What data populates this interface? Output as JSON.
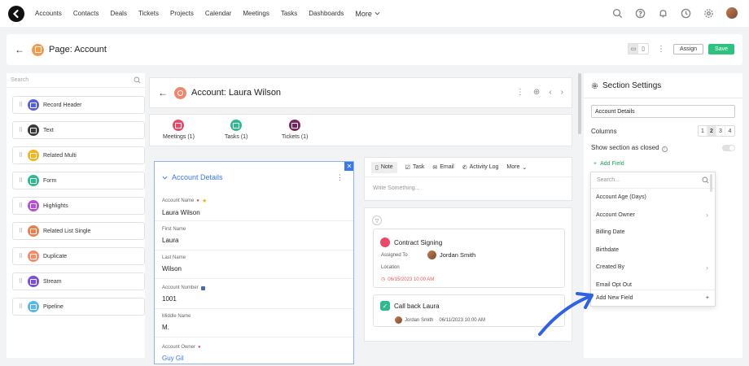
{
  "nav": {
    "items": [
      "Accounts",
      "Contacts",
      "Deals",
      "Tickets",
      "Projects",
      "Calendar",
      "Meetings",
      "Tasks",
      "Dashboards"
    ],
    "more_label": "More"
  },
  "page_header": {
    "title": "Page: Account",
    "assign_label": "Assign",
    "save_label": "Save"
  },
  "palette": {
    "search_placeholder": "Search",
    "items": [
      {
        "label": "Record Header",
        "color": "#5b5fd6"
      },
      {
        "label": "Text",
        "color": "#3a3a3a"
      },
      {
        "label": "Related Multi",
        "color": "#f2b51e"
      },
      {
        "label": "Form",
        "color": "#2fb98f"
      },
      {
        "label": "Highlights",
        "color": "#b64fd3"
      },
      {
        "label": "Related List Single",
        "color": "#e9804f"
      },
      {
        "label": "Duplicate",
        "color": "#f08c6a"
      },
      {
        "label": "Stream",
        "color": "#7d4fd8"
      },
      {
        "label": "Pipeline",
        "color": "#5bb7e6"
      }
    ]
  },
  "record": {
    "title": "Account: Laura Wilson"
  },
  "related": [
    {
      "label": "Meetings (1)",
      "color": "#e94a6a"
    },
    {
      "label": "Tasks (1)",
      "color": "#2fb98f"
    },
    {
      "label": "Tickets (1)",
      "color": "#7a2460"
    }
  ],
  "details": {
    "title": "Account Details",
    "fields": [
      {
        "label": "Account Name",
        "value": "Laura Wilson",
        "required": true,
        "starred": true
      },
      {
        "label": "First Name",
        "value": "Laura"
      },
      {
        "label": "Last Name",
        "value": "Wilson"
      },
      {
        "label": "Account Number",
        "value": "1001",
        "locked": true
      },
      {
        "label": "Middle Name",
        "value": "M."
      },
      {
        "label": "Account Owner",
        "value": "Guy Gil",
        "required": true,
        "link": true
      }
    ]
  },
  "activity": {
    "tabs": [
      "Note",
      "Task",
      "Email",
      "Activity Log",
      "More"
    ],
    "placeholder": "Write Something..."
  },
  "timeline": {
    "card1": {
      "title": "Contract Signing",
      "assigned_label": "Assigned To",
      "assignee": "Jordan Smith",
      "location_label": "Location",
      "datetime": "06/15/2023 10:00 AM"
    },
    "card2": {
      "title": "Call back Laura",
      "assignee": "Jordan Smith",
      "datetime": "06/11/2023 10:00 AM"
    }
  },
  "settings": {
    "title": "Section Settings",
    "section_name": "Account Details",
    "columns_label": "Columns",
    "columns": [
      "1",
      "2",
      "3",
      "4"
    ],
    "columns_selected": "2",
    "closed_label": "Show section as closed",
    "add_field_label": "Add Field",
    "dropdown": {
      "search_placeholder": "Search...",
      "items": [
        {
          "label": "Account Age (Days)",
          "submenu": false
        },
        {
          "label": "Account Owner",
          "submenu": true
        },
        {
          "label": "Billing Date",
          "submenu": false
        },
        {
          "label": "Birthdate",
          "submenu": false
        },
        {
          "label": "Created By",
          "submenu": true
        },
        {
          "label": "Email Opt Out",
          "submenu": false
        }
      ],
      "add_new_label": "Add New Field"
    }
  },
  "colors": {
    "accent_blue": "#3a78e6",
    "save_green": "#2ec27e",
    "annotation_arrow": "#2f63e0"
  }
}
